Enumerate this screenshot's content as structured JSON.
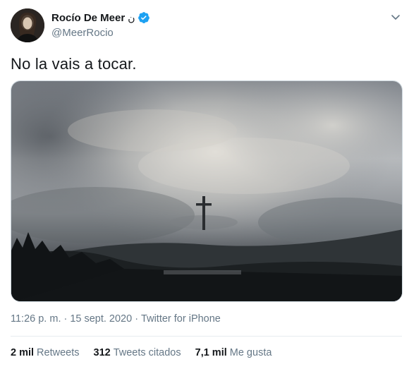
{
  "author": {
    "name": "Rocío De Meer",
    "name_suffix": "ن",
    "handle": "@MeerRocio"
  },
  "tweet": {
    "text": "No la vais a tocar."
  },
  "meta": {
    "time": "11:26 p. m.",
    "separator1": "·",
    "date": "15 sept. 2020",
    "separator2": "·",
    "source": "Twitter for iPhone"
  },
  "stats": [
    {
      "count": "2 mil",
      "label": "Retweets"
    },
    {
      "count": "312",
      "label": "Tweets citados"
    },
    {
      "count": "7,1 mil",
      "label": "Me gusta"
    }
  ],
  "colors": {
    "verified": "#1da1f2",
    "secondary_text": "#657786",
    "divider": "#e6ecf0"
  },
  "icons": {
    "verified": "verified-badge-icon",
    "caret": "chevron-down-icon"
  }
}
